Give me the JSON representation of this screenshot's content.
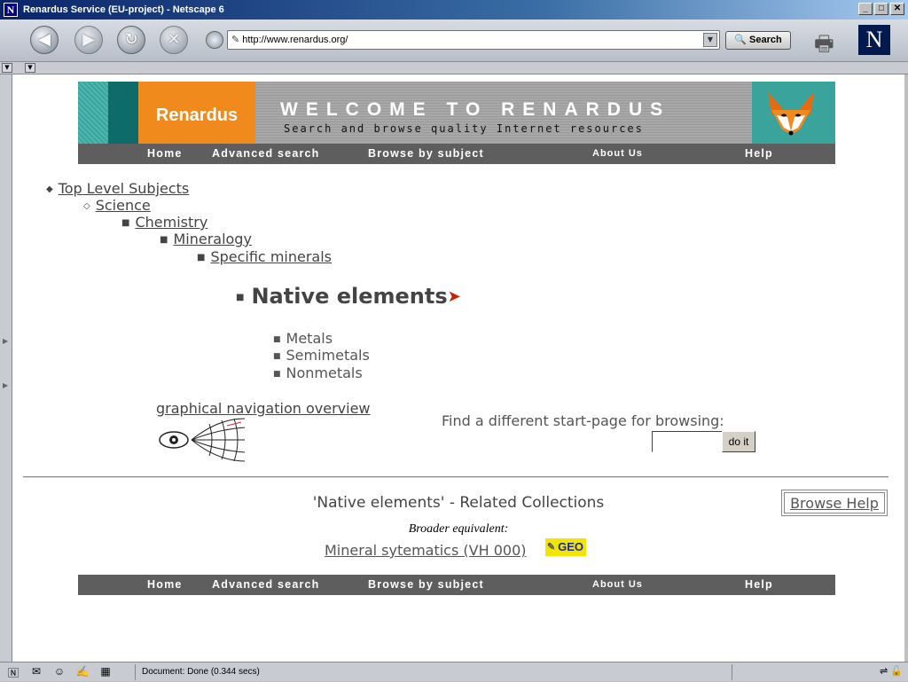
{
  "window": {
    "title": "Renardus Service (EU-project) - Netscape 6",
    "minimize": "_",
    "maximize": "□",
    "close": "✕"
  },
  "toolbar": {
    "url": "http://www.renardus.org/",
    "search_label": "Search"
  },
  "banner": {
    "logo": "Renardus",
    "welcome": "WELCOME TO RENARDUS",
    "tagline": "Search and browse quality Internet resources"
  },
  "menu": {
    "home": "Home",
    "advanced_search": "Advanced search",
    "browse_by_subject": "Browse by subject",
    "about_us": "About Us",
    "help": "Help"
  },
  "breadcrumb": [
    "Top Level Subjects",
    "Science",
    "Chemistry",
    "Mineralogy",
    "Specific minerals"
  ],
  "current": {
    "title": "Native elements"
  },
  "children": [
    "Metals",
    "Semimetals",
    "Nonmetals"
  ],
  "graphical_nav": {
    "link": "graphical navigation overview"
  },
  "find": {
    "label": "Find a different start-page for browsing:",
    "input_value": "",
    "button": "do it"
  },
  "related": {
    "title": "'Native elements' - Related Collections",
    "browse_help": "Browse Help",
    "broader_label": "Broader equivalent:",
    "broader_link": "Mineral sytematics (VH 000)",
    "badge": "GEO"
  },
  "status": {
    "message": "Document: Done (0.344 secs)"
  },
  "colors": {
    "menu_bg": "#5e5e5e",
    "banner_orange": "#f08a1c",
    "banner_teal": "#3aa39c",
    "text_grey": "#444444",
    "geo_yellow": "#f2e600"
  },
  "icons": [
    "back-icon",
    "forward-icon",
    "reload-icon",
    "stop-icon",
    "print-icon",
    "netscape-logo-icon",
    "eye-navigation-icon",
    "pointer-arrow-icon"
  ]
}
